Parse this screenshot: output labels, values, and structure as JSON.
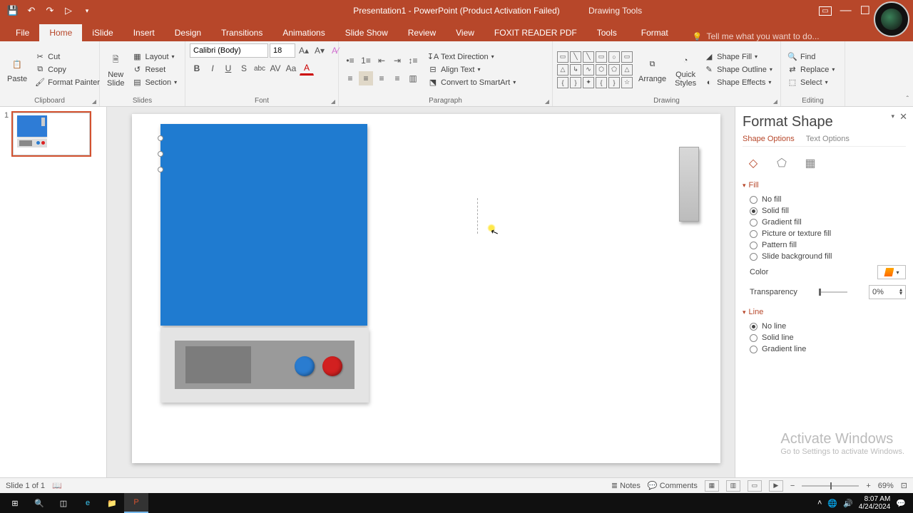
{
  "title": "Presentation1 - PowerPoint (Product Activation Failed)",
  "context_tab": "Drawing Tools",
  "tabs": {
    "file": "File",
    "home": "Home",
    "islide": "iSlide",
    "insert": "Insert",
    "design": "Design",
    "transitions": "Transitions",
    "animations": "Animations",
    "slideshow": "Slide Show",
    "review": "Review",
    "view": "View",
    "foxit": "FOXIT READER PDF",
    "tools": "Tools",
    "format": "Format"
  },
  "tell_me": "Tell me what you want to do...",
  "clipboard": {
    "paste": "Paste",
    "cut": "Cut",
    "copy": "Copy",
    "painter": "Format Painter",
    "label": "Clipboard"
  },
  "slides": {
    "new": "New\nSlide",
    "layout": "Layout",
    "reset": "Reset",
    "section": "Section",
    "label": "Slides"
  },
  "font": {
    "name": "Calibri (Body)",
    "size": "18",
    "label": "Font"
  },
  "paragraph": {
    "textdir": "Text Direction",
    "align": "Align Text",
    "smartart": "Convert to SmartArt",
    "label": "Paragraph"
  },
  "drawing": {
    "arrange": "Arrange",
    "quick": "Quick\nStyles",
    "fill": "Shape Fill",
    "outline": "Shape Outline",
    "effects": "Shape Effects",
    "label": "Drawing"
  },
  "editing": {
    "find": "Find",
    "replace": "Replace",
    "select": "Select",
    "label": "Editing"
  },
  "thumb_number": "1",
  "format_pane": {
    "title": "Format Shape",
    "tab_shape": "Shape Options",
    "tab_text": "Text Options",
    "fill_head": "Fill",
    "fill_options": {
      "none": "No fill",
      "solid": "Solid fill",
      "gradient": "Gradient fill",
      "picture": "Picture or texture fill",
      "pattern": "Pattern fill",
      "bg": "Slide background fill"
    },
    "color_label": "Color",
    "transparency_label": "Transparency",
    "transparency_value": "0%",
    "line_head": "Line",
    "line_options": {
      "none": "No line",
      "solid": "Solid line",
      "gradient": "Gradient line"
    }
  },
  "watermark": {
    "title": "Activate Windows",
    "sub": "Go to Settings to activate Windows."
  },
  "status": {
    "slide": "Slide 1 of 1",
    "notes": "Notes",
    "comments": "Comments",
    "zoom": "69%"
  },
  "tray": {
    "time": "8:07 AM",
    "date": "4/24/2024"
  }
}
